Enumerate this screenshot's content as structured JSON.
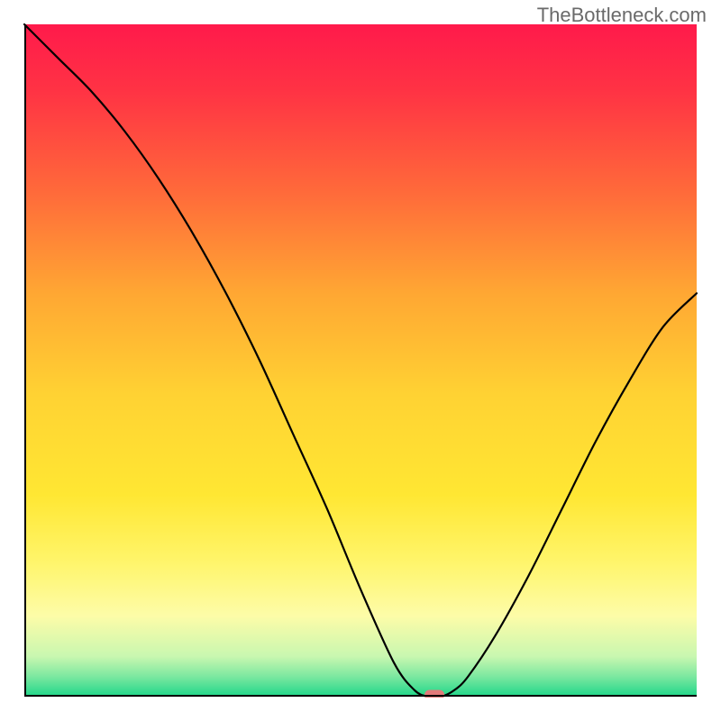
{
  "watermark": "TheBottleneck.com",
  "chart_data": {
    "type": "line",
    "title": "",
    "xlabel": "",
    "ylabel": "",
    "xlim": [
      0,
      100
    ],
    "ylim": [
      0,
      100
    ],
    "grid": false,
    "series": [
      {
        "name": "curve",
        "x": [
          0,
          5,
          10,
          15,
          20,
          25,
          30,
          35,
          40,
          45,
          50,
          55,
          58,
          60,
          62,
          64,
          66,
          70,
          75,
          80,
          85,
          90,
          95,
          100
        ],
        "values": [
          100,
          95,
          90,
          84,
          77,
          69,
          60,
          50,
          39,
          28,
          16,
          5,
          1,
          0,
          0,
          1,
          3,
          9,
          18,
          28,
          38,
          47,
          55,
          60
        ]
      }
    ],
    "marker": {
      "x": 61,
      "y": 0,
      "color": "#e27a7a"
    },
    "gradient_stops": [
      {
        "offset": 0.0,
        "color": "#ff1a4b"
      },
      {
        "offset": 0.1,
        "color": "#ff3344"
      },
      {
        "offset": 0.25,
        "color": "#ff6a3a"
      },
      {
        "offset": 0.4,
        "color": "#ffa733"
      },
      {
        "offset": 0.55,
        "color": "#ffd233"
      },
      {
        "offset": 0.7,
        "color": "#ffe733"
      },
      {
        "offset": 0.8,
        "color": "#fff56b"
      },
      {
        "offset": 0.88,
        "color": "#fdfca8"
      },
      {
        "offset": 0.94,
        "color": "#c9f7b0"
      },
      {
        "offset": 0.97,
        "color": "#7ce8a0"
      },
      {
        "offset": 1.0,
        "color": "#1fd68a"
      }
    ],
    "axis_color": "#000000",
    "axis_width": 2,
    "line_color": "#000000",
    "line_width": 2.2
  }
}
